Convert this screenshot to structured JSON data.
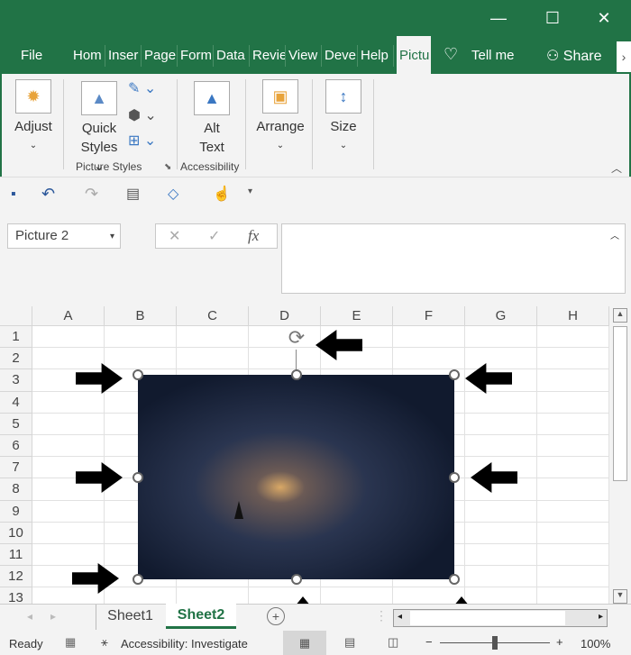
{
  "window": {
    "minimize": "—",
    "maximize": "☐",
    "close": "✕"
  },
  "tabs": [
    "File",
    "Hom",
    "Inser",
    "Page",
    "Form",
    "Data",
    "Revie",
    "View",
    "Deve",
    "Help",
    "Pictu"
  ],
  "tell_me": "Tell me",
  "share": "Share",
  "more": "›",
  "ribbon": {
    "adjust": "Adjust",
    "quick": "Quick",
    "styles": "Styles",
    "alt": "Alt",
    "text": "Text",
    "arrange": "Arrange",
    "size": "Size",
    "group_picture_styles": "Picture Styles",
    "group_accessibility": "Accessibility"
  },
  "name_box": "Picture 2",
  "fx": "fx",
  "columns": [
    "A",
    "B",
    "C",
    "D",
    "E",
    "F",
    "G",
    "H"
  ],
  "rows": [
    "1",
    "2",
    "3",
    "4",
    "5",
    "6",
    "7",
    "8",
    "9",
    "10",
    "11",
    "12",
    "13"
  ],
  "sheets": [
    "Sheet1",
    "Sheet2"
  ],
  "active_sheet": "Sheet2",
  "status": {
    "ready": "Ready",
    "accessibility": "Accessibility: Investigate",
    "zoom": "100%"
  },
  "colors": {
    "brand": "#217346"
  }
}
